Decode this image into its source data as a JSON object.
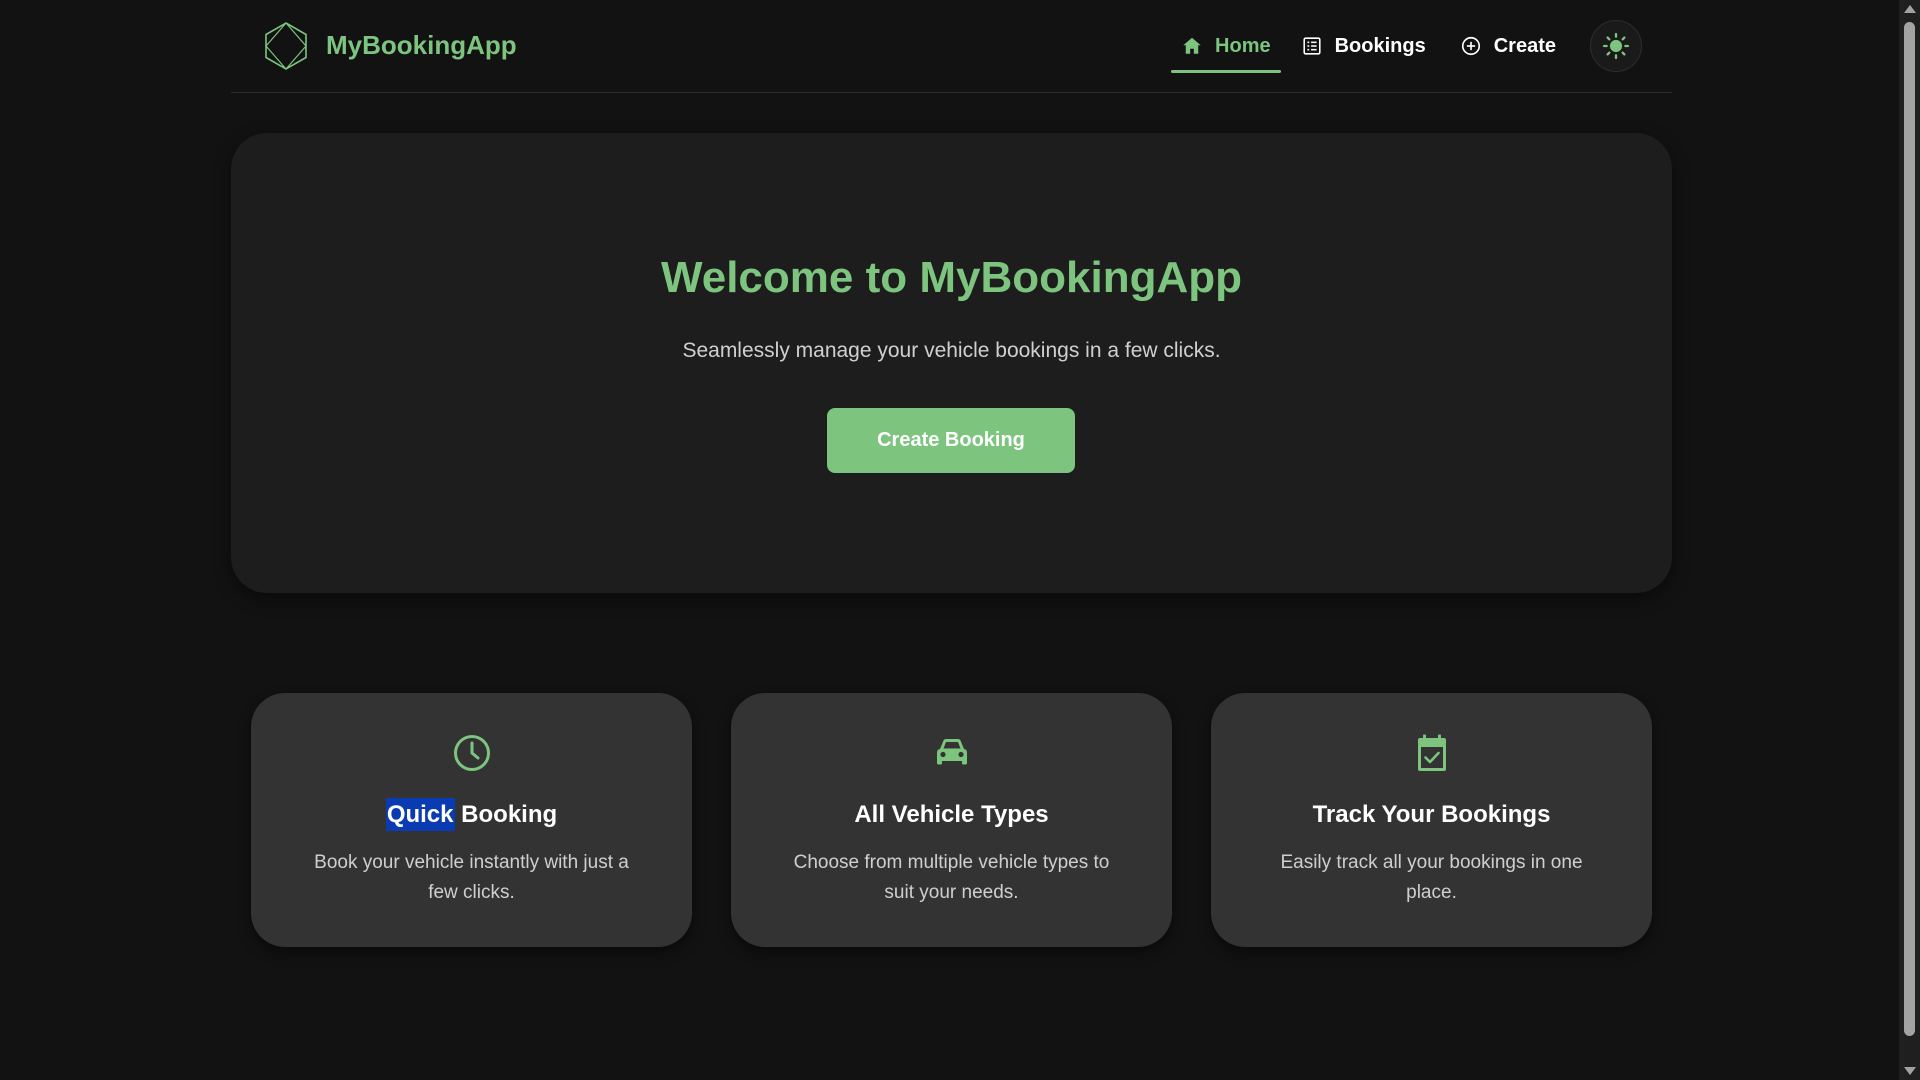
{
  "header": {
    "brand_name": "MyBookingApp",
    "nav": [
      {
        "label": "Home",
        "icon": "home-icon",
        "active": true
      },
      {
        "label": "Bookings",
        "icon": "list-icon",
        "active": false
      },
      {
        "label": "Create",
        "icon": "plus-circle-icon",
        "active": false
      }
    ],
    "theme_toggle_icon": "sun-icon"
  },
  "hero": {
    "title": "Welcome to MyBookingApp",
    "subtitle": "Seamlessly manage your vehicle bookings in a few clicks.",
    "cta_label": "Create Booking"
  },
  "features": [
    {
      "icon": "clock-icon",
      "title_highlight": "Quick",
      "title_rest": " Booking",
      "description": "Book your vehicle instantly with just a few clicks."
    },
    {
      "icon": "car-icon",
      "title": "All Vehicle Types",
      "description": "Choose from multiple vehicle types to suit your needs."
    },
    {
      "icon": "calendar-check-icon",
      "title": "Track Your Bookings",
      "description": "Easily track all your bookings in one place."
    }
  ],
  "colors": {
    "accent": "#7dc47f",
    "background": "#121212",
    "hero_bg": "#1d1d1d",
    "card_bg": "#333333",
    "selection": "#0a3bb3"
  }
}
